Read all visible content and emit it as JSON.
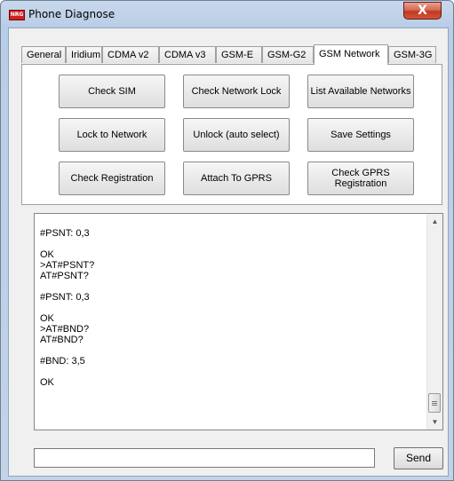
{
  "window": {
    "title": "Phone Diagnose",
    "app_icon_label": "NRG",
    "close_label": "X"
  },
  "tabs": [
    {
      "label": "General"
    },
    {
      "label": "Iridium"
    },
    {
      "label": "CDMA v2"
    },
    {
      "label": "CDMA v3"
    },
    {
      "label": "GSM-E"
    },
    {
      "label": "GSM-G2"
    },
    {
      "label": "GSM Network",
      "active": true
    },
    {
      "label": "GSM-3G"
    }
  ],
  "gsm_network": {
    "buttons": [
      {
        "label": "Check SIM"
      },
      {
        "label": "Check Network Lock"
      },
      {
        "label": "List Available Networks"
      },
      {
        "label": "Lock to Network"
      },
      {
        "label": "Unlock (auto select)"
      },
      {
        "label": "Save Settings"
      },
      {
        "label": "Check Registration"
      },
      {
        "label": "Attach To GPRS"
      },
      {
        "label": "Check GPRS Registration"
      }
    ]
  },
  "output": {
    "text": "#PSNT: 0,3\n\nOK\n>AT#PSNT?\nAT#PSNT?\n\n#PSNT: 0,3\n\nOK\n>AT#BND?\nAT#BND?\n\n#BND: 3,5\n\nOK"
  },
  "command": {
    "value": "",
    "send_label": "Send"
  }
}
